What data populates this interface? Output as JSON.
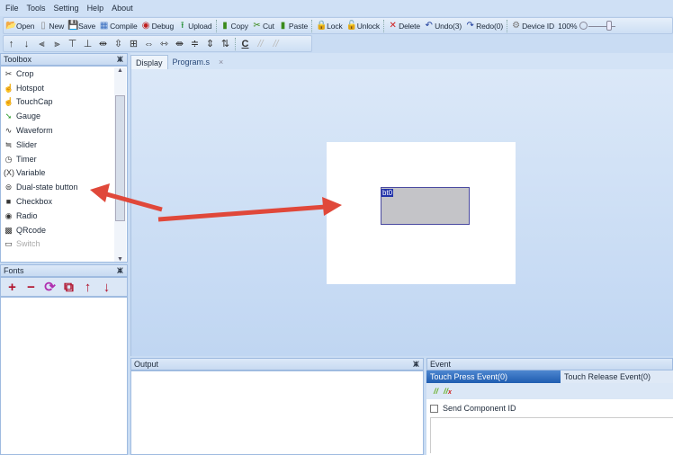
{
  "menu": [
    "File",
    "Tools",
    "Setting",
    "Help",
    "About"
  ],
  "toolbar1": [
    {
      "label": "Open",
      "icon": "folder-open-icon",
      "glyph": "📂",
      "color": "#d49a2a"
    },
    {
      "label": "New",
      "icon": "new-file-icon",
      "glyph": "▯",
      "color": "#888"
    },
    {
      "label": "Save",
      "icon": "save-icon",
      "glyph": "💾",
      "color": "#222"
    },
    {
      "label": "Compile",
      "icon": "compile-icon",
      "glyph": "▦",
      "color": "#3a6fc0"
    },
    {
      "label": "Debug",
      "icon": "debug-icon",
      "glyph": "◉",
      "color": "#c02020"
    },
    {
      "label": "Upload",
      "icon": "upload-icon",
      "glyph": "⭱",
      "color": "#1a8a2a"
    },
    {
      "label": "Copy",
      "icon": "copy-icon",
      "glyph": "▮",
      "color": "#3a8a1a"
    },
    {
      "label": "Cut",
      "icon": "cut-icon",
      "glyph": "✂",
      "color": "#3a8a1a"
    },
    {
      "label": "Paste",
      "icon": "paste-icon",
      "glyph": "▮",
      "color": "#3a8a1a"
    },
    {
      "label": "Lock",
      "icon": "lock-icon",
      "glyph": "🔒",
      "color": "#3a9a2a"
    },
    {
      "label": "Unlock",
      "icon": "unlock-icon",
      "glyph": "🔓",
      "color": "#3a9a2a"
    },
    {
      "label": "Delete",
      "icon": "delete-icon",
      "glyph": "✕",
      "color": "#d02020"
    },
    {
      "label": "Undo(3)",
      "icon": "undo-icon",
      "glyph": "↶",
      "color": "#1a3a9a"
    },
    {
      "label": "Redo(0)",
      "icon": "redo-icon",
      "glyph": "↷",
      "color": "#1a3a9a"
    },
    {
      "label": "Device ID",
      "icon": "gear-icon",
      "glyph": "⚙",
      "color": "#777"
    }
  ],
  "zoom": "100%",
  "toolbar2": [
    {
      "icon": "move-up-icon",
      "glyph": "↑"
    },
    {
      "icon": "move-down-icon",
      "glyph": "↓"
    },
    {
      "icon": "align-left-icon",
      "glyph": "⫷"
    },
    {
      "icon": "align-right-icon",
      "glyph": "⫸"
    },
    {
      "icon": "align-top-icon",
      "glyph": "⊤"
    },
    {
      "icon": "align-bottom-icon",
      "glyph": "⊥"
    },
    {
      "icon": "center-horizontal-icon",
      "glyph": "⇹"
    },
    {
      "icon": "center-vertical-icon",
      "glyph": "⇳"
    },
    {
      "icon": "center-icon",
      "glyph": "⊞"
    },
    {
      "icon": "same-width-icon",
      "glyph": "⇔"
    },
    {
      "icon": "hspace-inc-icon",
      "glyph": "⇿"
    },
    {
      "icon": "hspace-dec-icon",
      "glyph": "⇼"
    },
    {
      "icon": "vspace-icon",
      "glyph": "≑"
    },
    {
      "icon": "vspace-inc-icon",
      "glyph": "⇕"
    },
    {
      "icon": "vspace-dec-icon",
      "glyph": "⇅"
    },
    {
      "icon": "code-icon",
      "glyph": "C"
    },
    {
      "icon": "comment-icon",
      "glyph": "//"
    },
    {
      "icon": "uncomment-icon",
      "glyph": "//"
    }
  ],
  "toolbox": {
    "title": "Toolbox",
    "items": [
      {
        "label": "Crop",
        "icon": "scissors-icon",
        "glyph": "✂"
      },
      {
        "label": "Hotspot",
        "icon": "hand-icon",
        "glyph": "☝"
      },
      {
        "label": "TouchCap",
        "icon": "hand-icon",
        "glyph": "☝"
      },
      {
        "label": "Gauge",
        "icon": "gauge-icon",
        "glyph": "➘"
      },
      {
        "label": "Waveform",
        "icon": "waveform-icon",
        "glyph": "∿"
      },
      {
        "label": "Slider",
        "icon": "slider-icon",
        "glyph": "≒"
      },
      {
        "label": "Timer",
        "icon": "clock-icon",
        "glyph": "◷"
      },
      {
        "label": "Variable",
        "icon": "variable-icon",
        "glyph": "(X)"
      },
      {
        "label": "Dual-state button",
        "icon": "dual-state-button-icon",
        "glyph": "⊜"
      },
      {
        "label": "Checkbox",
        "icon": "checkbox-icon",
        "glyph": "■"
      },
      {
        "label": "Radio",
        "icon": "radio-icon",
        "glyph": "◉"
      },
      {
        "label": "QRcode",
        "icon": "qrcode-icon",
        "glyph": "▩"
      },
      {
        "label": "Switch",
        "icon": "switch-icon",
        "glyph": "▭"
      }
    ]
  },
  "fonts": {
    "title": "Fonts",
    "tools": [
      {
        "icon": "add-icon",
        "glyph": "+"
      },
      {
        "icon": "remove-icon",
        "glyph": "−"
      },
      {
        "icon": "refresh-icon",
        "glyph": "⟳"
      },
      {
        "icon": "edit-icon",
        "glyph": "⧉"
      },
      {
        "icon": "arrow-up-icon",
        "glyph": "↑"
      },
      {
        "icon": "arrow-down-icon",
        "glyph": "↓"
      }
    ]
  },
  "tabs": [
    {
      "label": "Display"
    },
    {
      "label": "Program.s"
    }
  ],
  "canvas": {
    "component_label": "bt0"
  },
  "output": {
    "title": "Output"
  },
  "event": {
    "title": "Event",
    "tabs": [
      "Touch Press Event(0)",
      "Touch Release Event(0)"
    ],
    "send_component_id": "Send Component ID"
  },
  "pin_glyph": "ⵥ"
}
